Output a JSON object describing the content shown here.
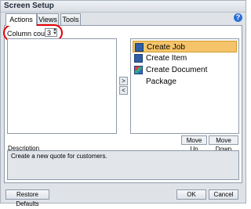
{
  "window": {
    "title": "Screen Setup"
  },
  "tabs": [
    {
      "label": "Actions",
      "active": true
    },
    {
      "label": "Views",
      "active": false
    },
    {
      "label": "Tools",
      "active": false
    }
  ],
  "help": {
    "glyph": "?"
  },
  "column_count": {
    "label": "Column count:",
    "value": "3"
  },
  "arrows": {
    "right": ">",
    "left": "<"
  },
  "available_list": {
    "items": []
  },
  "selected_list": {
    "items": [
      {
        "label": "Create Job",
        "selected": true,
        "icon": "create-job-icon"
      },
      {
        "label": "Create Item",
        "selected": false,
        "icon": "create-item-icon"
      },
      {
        "label": "Create Document Package",
        "selected": false,
        "icon": "document-package-icon"
      }
    ]
  },
  "buttons": {
    "move_up": "Move Up",
    "move_down": "Move Down",
    "restore_defaults": "Restore Defaults",
    "ok": "OK",
    "cancel": "Cancel"
  },
  "description": {
    "label": "Description",
    "text": "Create a new quote for customers."
  },
  "colors": {
    "selection": "#f5c46a",
    "highlight_ring": "#e10000",
    "help": "#2b6fd6"
  }
}
